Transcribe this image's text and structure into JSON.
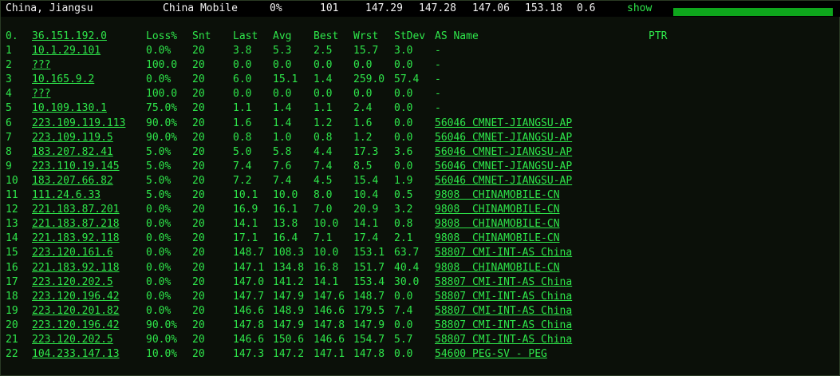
{
  "header": {
    "location": "China, Jiangsu",
    "isp": "China Mobile",
    "loss": "0%",
    "sent": "101",
    "last": "147.29",
    "avg": "147.28",
    "best": "147.06",
    "worst": "153.18",
    "stdev": "0.6",
    "show_label": "show",
    "progress_fraction": 1.0
  },
  "columns": {
    "hop": "0.",
    "host": "36.151.192.0",
    "loss": "Loss%",
    "snt": "Snt",
    "last": "Last",
    "avg": "Avg",
    "best": "Best",
    "wrst": "Wrst",
    "stdev": "StDev",
    "asname": "AS Name",
    "ptr": "PTR"
  },
  "rows": [
    {
      "hop": "1",
      "host": "10.1.29.101",
      "loss": "0.0%",
      "snt": "20",
      "last": "3.8",
      "avg": "5.3",
      "best": "2.5",
      "wrst": "15.7",
      "stdev": "3.0",
      "asname": "-"
    },
    {
      "hop": "2",
      "host": "???",
      "loss": "100.0",
      "snt": "20",
      "last": "0.0",
      "avg": "0.0",
      "best": "0.0",
      "wrst": "0.0",
      "stdev": "0.0",
      "asname": "-"
    },
    {
      "hop": "3",
      "host": "10.165.9.2",
      "loss": "0.0%",
      "snt": "20",
      "last": "6.0",
      "avg": "15.1",
      "best": "1.4",
      "wrst": "259.0",
      "stdev": "57.4",
      "asname": "-"
    },
    {
      "hop": "4",
      "host": "???",
      "loss": "100.0",
      "snt": "20",
      "last": "0.0",
      "avg": "0.0",
      "best": "0.0",
      "wrst": "0.0",
      "stdev": "0.0",
      "asname": "-"
    },
    {
      "hop": "5",
      "host": "10.109.130.1",
      "loss": "75.0%",
      "snt": "20",
      "last": "1.1",
      "avg": "1.4",
      "best": "1.1",
      "wrst": "2.4",
      "stdev": "0.0",
      "asname": "-"
    },
    {
      "hop": "6",
      "host": "223.109.119.113",
      "loss": "90.0%",
      "snt": "20",
      "last": "1.6",
      "avg": "1.4",
      "best": "1.2",
      "wrst": "1.6",
      "stdev": "0.0",
      "asname": "56046 CMNET-JIANGSU-AP"
    },
    {
      "hop": "7",
      "host": "223.109.119.5",
      "loss": "90.0%",
      "snt": "20",
      "last": "0.8",
      "avg": "1.0",
      "best": "0.8",
      "wrst": "1.2",
      "stdev": "0.0",
      "asname": "56046 CMNET-JIANGSU-AP"
    },
    {
      "hop": "8",
      "host": "183.207.82.41",
      "loss": "5.0%",
      "snt": "20",
      "last": "5.0",
      "avg": "5.8",
      "best": "4.4",
      "wrst": "17.3",
      "stdev": "3.6",
      "asname": "56046 CMNET-JIANGSU-AP"
    },
    {
      "hop": "9",
      "host": "223.110.19.145",
      "loss": "5.0%",
      "snt": "20",
      "last": "7.4",
      "avg": "7.6",
      "best": "7.4",
      "wrst": "8.5",
      "stdev": "0.0",
      "asname": "56046 CMNET-JIANGSU-AP"
    },
    {
      "hop": "10",
      "host": "183.207.66.82",
      "loss": "5.0%",
      "snt": "20",
      "last": "7.2",
      "avg": "7.4",
      "best": "4.5",
      "wrst": "15.4",
      "stdev": "1.9",
      "asname": "56046 CMNET-JIANGSU-AP"
    },
    {
      "hop": "11",
      "host": "111.24.6.33",
      "loss": "5.0%",
      "snt": "20",
      "last": "10.1",
      "avg": "10.0",
      "best": "8.0",
      "wrst": "10.4",
      "stdev": "0.5",
      "asname": "9808  CHINAMOBILE-CN"
    },
    {
      "hop": "12",
      "host": "221.183.87.201",
      "loss": "0.0%",
      "snt": "20",
      "last": "16.9",
      "avg": "16.1",
      "best": "7.0",
      "wrst": "20.9",
      "stdev": "3.2",
      "asname": "9808  CHINAMOBILE-CN"
    },
    {
      "hop": "13",
      "host": "221.183.87.218",
      "loss": "0.0%",
      "snt": "20",
      "last": "14.1",
      "avg": "13.8",
      "best": "10.0",
      "wrst": "14.1",
      "stdev": "0.8",
      "asname": "9808  CHINAMOBILE-CN"
    },
    {
      "hop": "14",
      "host": "221.183.92.118",
      "loss": "0.0%",
      "snt": "20",
      "last": "17.1",
      "avg": "16.4",
      "best": "7.1",
      "wrst": "17.4",
      "stdev": "2.1",
      "asname": "9808  CHINAMOBILE-CN"
    },
    {
      "hop": "15",
      "host": "223.120.161.6",
      "loss": "0.0%",
      "snt": "20",
      "last": "148.7",
      "avg": "108.3",
      "best": "10.0",
      "wrst": "153.1",
      "stdev": "63.7",
      "asname": "58807 CMI-INT-AS China"
    },
    {
      "hop": "16",
      "host": "221.183.92.118",
      "loss": "0.0%",
      "snt": "20",
      "last": "147.1",
      "avg": "134.8",
      "best": "16.8",
      "wrst": "151.7",
      "stdev": "40.4",
      "asname": "9808  CHINAMOBILE-CN"
    },
    {
      "hop": "17",
      "host": "223.120.202.5",
      "loss": "0.0%",
      "snt": "20",
      "last": "147.0",
      "avg": "141.2",
      "best": "14.1",
      "wrst": "153.4",
      "stdev": "30.0",
      "asname": "58807 CMI-INT-AS China"
    },
    {
      "hop": "18",
      "host": "223.120.196.42",
      "loss": "0.0%",
      "snt": "20",
      "last": "147.7",
      "avg": "147.9",
      "best": "147.6",
      "wrst": "148.7",
      "stdev": "0.0",
      "asname": "58807 CMI-INT-AS China"
    },
    {
      "hop": "19",
      "host": "223.120.201.82",
      "loss": "0.0%",
      "snt": "20",
      "last": "146.6",
      "avg": "148.9",
      "best": "146.6",
      "wrst": "179.5",
      "stdev": "7.4",
      "asname": "58807 CMI-INT-AS China"
    },
    {
      "hop": "20",
      "host": "223.120.196.42",
      "loss": "90.0%",
      "snt": "20",
      "last": "147.8",
      "avg": "147.9",
      "best": "147.8",
      "wrst": "147.9",
      "stdev": "0.0",
      "asname": "58807 CMI-INT-AS China"
    },
    {
      "hop": "21",
      "host": "223.120.202.5",
      "loss": "90.0%",
      "snt": "20",
      "last": "146.6",
      "avg": "150.6",
      "best": "146.6",
      "wrst": "154.7",
      "stdev": "5.7",
      "asname": "58807 CMI-INT-AS China"
    },
    {
      "hop": "22",
      "host": "104.233.147.13",
      "loss": "10.0%",
      "snt": "20",
      "last": "147.3",
      "avg": "147.2",
      "best": "147.1",
      "wrst": "147.8",
      "stdev": "0.0",
      "asname": "54600 PEG-SV - PEG"
    }
  ],
  "colors": {
    "text_green": "#2ee64a",
    "topbar_bg": "#000000",
    "body_bg": "#0b1009",
    "progress_fill": "#0ea61c"
  }
}
